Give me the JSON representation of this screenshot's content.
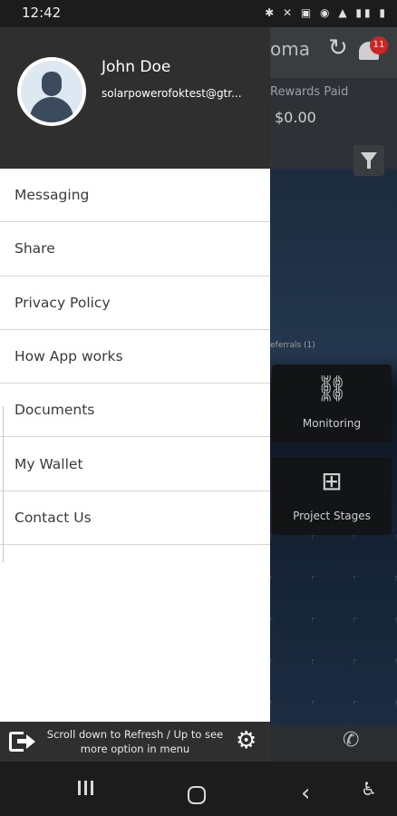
{
  "status_bar": {
    "time": "12:42",
    "icons": [
      "bluetooth-icon",
      "mute-icon",
      "battery-saver-icon",
      "wifi-icon",
      "signal-icon",
      "signal-icon",
      "battery-icon"
    ]
  },
  "background_app": {
    "title": "oma",
    "rewards_label": "Rewards Paid",
    "rewards_value": "$0.00",
    "referrals_text": "eferrals (1)",
    "notification_count": "11",
    "tiles": [
      {
        "label": "Monitoring",
        "icon": "link-icon"
      },
      {
        "label": "Project Stages",
        "icon": "flow-icon"
      }
    ]
  },
  "drawer": {
    "user": {
      "name": "John Doe",
      "email": "solarpowerofoktest@gtr..."
    },
    "menu": [
      {
        "label": "Messaging"
      },
      {
        "label": "Share"
      },
      {
        "label": "Privacy Policy"
      },
      {
        "label": "How App works"
      },
      {
        "label": "Documents"
      },
      {
        "label": "My Wallet"
      },
      {
        "label": "Contact Us"
      }
    ],
    "footer": {
      "hint": "Scroll down to Refresh / Up to see more option in menu",
      "logout_icon": "logout-icon",
      "settings_icon": "gear-icon"
    }
  },
  "nav_bar": {
    "buttons": [
      "recents-button",
      "home-button",
      "back-button",
      "accessibility-button"
    ]
  },
  "colors": {
    "drawer_header": "#2f2f2f",
    "drawer_bg": "#ffffff",
    "badge": "#c62828"
  }
}
